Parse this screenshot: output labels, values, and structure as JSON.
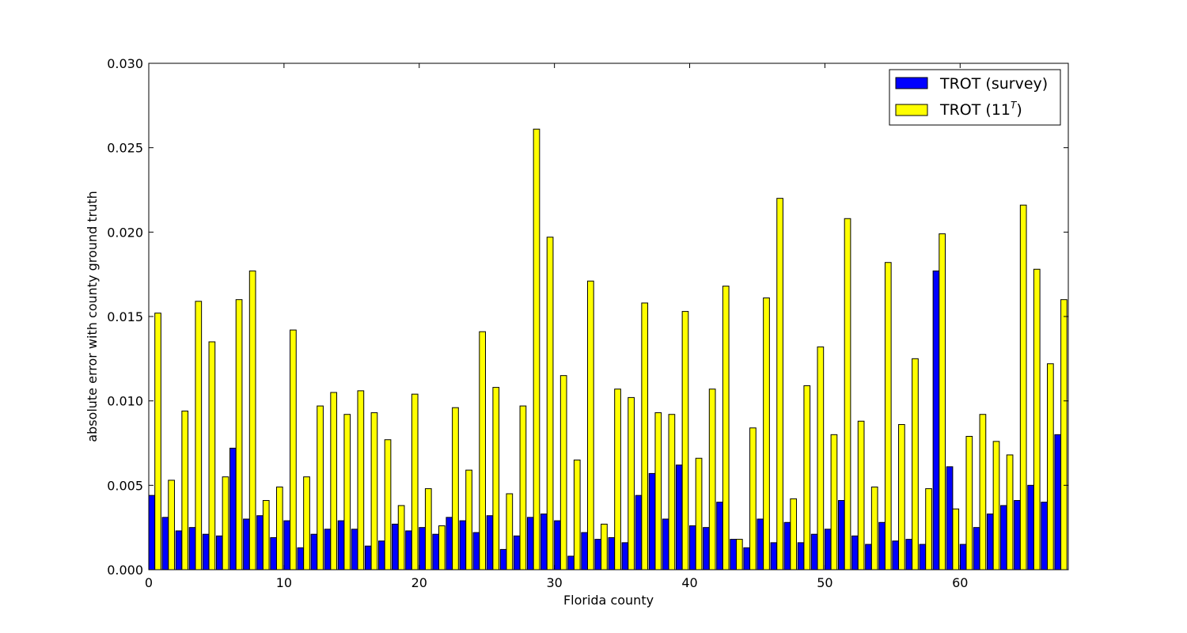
{
  "chart_data": {
    "type": "bar",
    "title": "",
    "xlabel": "Florida county",
    "ylabel": "absolute error with county ground truth",
    "xlim": [
      0,
      68
    ],
    "ylim": [
      0,
      0.03
    ],
    "x_ticks": [
      "0",
      "10",
      "20",
      "30",
      "40",
      "50",
      "60"
    ],
    "y_ticks": [
      "0.000",
      "0.005",
      "0.010",
      "0.015",
      "0.020",
      "0.025",
      "0.030"
    ],
    "legend_position": "top-right",
    "categories": [
      0,
      1,
      2,
      3,
      4,
      5,
      6,
      7,
      8,
      9,
      10,
      11,
      12,
      13,
      14,
      15,
      16,
      17,
      18,
      19,
      20,
      21,
      22,
      23,
      24,
      25,
      26,
      27,
      28,
      29,
      30,
      31,
      32,
      33,
      34,
      35,
      36,
      37,
      38,
      39,
      40,
      41,
      42,
      43,
      44,
      45,
      46,
      47,
      48,
      49,
      50,
      51,
      52,
      53,
      54,
      55,
      56,
      57,
      58,
      59,
      60,
      61,
      62,
      63,
      64,
      65,
      66,
      67
    ],
    "series": [
      {
        "name": "TROT (survey)",
        "color": "#0000ff",
        "values": [
          0.0044,
          0.0031,
          0.0023,
          0.0025,
          0.0021,
          0.002,
          0.0072,
          0.003,
          0.0032,
          0.0019,
          0.0029,
          0.0013,
          0.0021,
          0.0024,
          0.0029,
          0.0024,
          0.0014,
          0.0017,
          0.0027,
          0.0023,
          0.0025,
          0.0021,
          0.0031,
          0.0029,
          0.0022,
          0.0032,
          0.0012,
          0.002,
          0.0031,
          0.0033,
          0.0029,
          0.0008,
          0.0022,
          0.0018,
          0.0019,
          0.0016,
          0.0044,
          0.0057,
          0.003,
          0.0062,
          0.0026,
          0.0025,
          0.004,
          0.0018,
          0.0013,
          0.003,
          0.0016,
          0.0028,
          0.0016,
          0.0021,
          0.0024,
          0.0041,
          0.002,
          0.0015,
          0.0028,
          0.0017,
          0.0018,
          0.0015,
          0.0177,
          0.0061,
          0.0015,
          0.0025,
          0.0033,
          0.0038,
          0.0041,
          0.005,
          0.004,
          0.008
        ]
      },
      {
        "name": "TROT (11",
        "name_sup": "T",
        "name_suffix": ")",
        "color": "#ffff00",
        "values": [
          0.0152,
          0.0053,
          0.0094,
          0.0159,
          0.0135,
          0.0055,
          0.016,
          0.0177,
          0.0041,
          0.0049,
          0.0142,
          0.0055,
          0.0097,
          0.0105,
          0.0092,
          0.0106,
          0.0093,
          0.0077,
          0.0038,
          0.0104,
          0.0048,
          0.0026,
          0.0096,
          0.0059,
          0.0141,
          0.0108,
          0.0045,
          0.0097,
          0.0261,
          0.0197,
          0.0115,
          0.0065,
          0.0171,
          0.0027,
          0.0107,
          0.0102,
          0.0158,
          0.0093,
          0.0092,
          0.0153,
          0.0066,
          0.0107,
          0.0168,
          0.0018,
          0.0084,
          0.0161,
          0.022,
          0.0042,
          0.0109,
          0.0132,
          0.008,
          0.0208,
          0.0088,
          0.0049,
          0.0182,
          0.0086,
          0.0125,
          0.0048,
          0.0199,
          0.0036,
          0.0079,
          0.0092,
          0.0076,
          0.0068,
          0.0216,
          0.0178,
          0.0122,
          0.016
        ]
      }
    ]
  }
}
